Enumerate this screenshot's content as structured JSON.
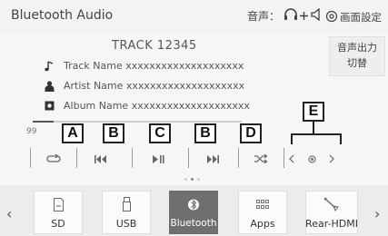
{
  "header": {
    "title": "Bluetooth Audio",
    "audio_output_label": "音声：",
    "settings_label": "画面設定"
  },
  "output_switch": {
    "line1": "音声出力",
    "line2": "切替"
  },
  "track": {
    "number": "TRACK 12345",
    "name": "Track Name xxxxxxxxxxxxxxxxxxxx",
    "artist": "Artist Name xxxxxxxxxxxxxxxxxxxx",
    "album": "Album Name xxxxxxxxxxxxxxxxxxxx"
  },
  "progress": {
    "time": "99",
    "fraction": 0.1
  },
  "controls": [
    {
      "name": "repeat",
      "icon": "repeat-icon"
    },
    {
      "name": "previous",
      "icon": "skip-back-icon"
    },
    {
      "name": "play-pause",
      "icon": "play-pause-icon"
    },
    {
      "name": "next",
      "icon": "skip-forward-icon"
    },
    {
      "name": "shuffle",
      "icon": "shuffle-icon"
    },
    {
      "name": "list-previous",
      "icon": "chevron-left-icon"
    },
    {
      "name": "list-center",
      "icon": "dot-icon"
    },
    {
      "name": "list-next",
      "icon": "chevron-right-icon"
    }
  ],
  "callouts": {
    "a": "A",
    "b1": "B",
    "c": "C",
    "b2": "B",
    "d": "D",
    "e": "E"
  },
  "page_dots": {
    "count": 3,
    "active": 1
  },
  "sources": [
    {
      "label": "SD",
      "icon": "sd-card-icon",
      "active": false
    },
    {
      "label": "USB",
      "icon": "usb-icon",
      "active": false
    },
    {
      "label": "Bluetooth",
      "icon": "bluetooth-icon",
      "active": true
    },
    {
      "label": "Apps",
      "icon": "apps-grid-icon",
      "active": false
    },
    {
      "label": "Rear-HDMI",
      "icon": "rear-hdmi-icon",
      "active": false
    }
  ],
  "source_nav": {
    "prev": "‹",
    "next": "›"
  },
  "colors": {
    "active_source": "#6f6f6f",
    "callout_border": "#222222"
  }
}
